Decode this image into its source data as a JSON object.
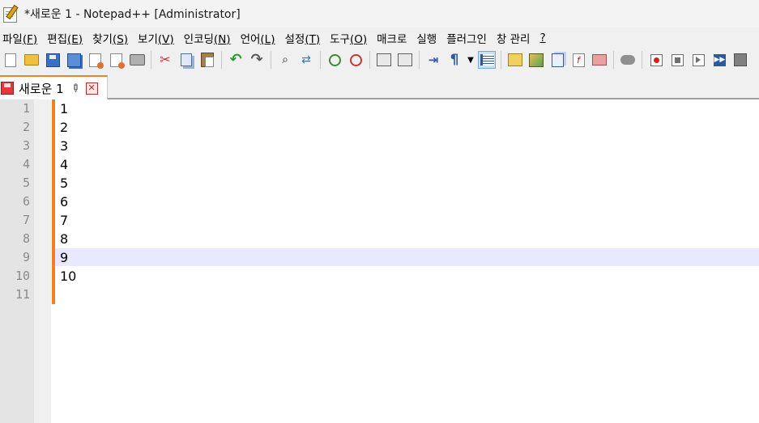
{
  "window": {
    "title": "*새로운 1 - Notepad++ [Administrator]"
  },
  "menu": {
    "items": [
      {
        "label": "파일",
        "accel": "(F)"
      },
      {
        "label": "편집",
        "accel": "(E)"
      },
      {
        "label": "찾기",
        "accel": "(S)"
      },
      {
        "label": "보기",
        "accel": "(V)"
      },
      {
        "label": "인코딩",
        "accel": "(N)"
      },
      {
        "label": "언어",
        "accel": "(L)"
      },
      {
        "label": "설정",
        "accel": "(T)"
      },
      {
        "label": "도구",
        "accel": "(O)"
      },
      {
        "label": "매크로",
        "accel": ""
      },
      {
        "label": "실행",
        "accel": ""
      },
      {
        "label": "플러그인",
        "accel": ""
      },
      {
        "label": "창 관리",
        "accel": ""
      },
      {
        "label": "",
        "accel": "?"
      }
    ]
  },
  "toolbar": {
    "icons": [
      "new-file-icon",
      "open-file-icon",
      "save-icon",
      "save-all-icon",
      "close-icon",
      "close-all-icon",
      "print-icon",
      "cut-icon",
      "copy-icon",
      "paste-icon",
      "undo-icon",
      "redo-icon",
      "find-icon",
      "replace-icon",
      "zoom-in-icon",
      "zoom-out-icon",
      "sync-vertical-icon",
      "sync-horizontal-icon",
      "word-wrap-icon",
      "show-all-chars-icon",
      "indent-guide-icon",
      "udl-icon",
      "doc-map-icon",
      "doc-list-icon",
      "function-list-icon",
      "folder-workspace-icon",
      "monitoring-icon",
      "record-macro-icon",
      "stop-record-icon",
      "playback-macro-icon",
      "run-macro-multiple-icon",
      "save-macro-icon"
    ]
  },
  "tabs": [
    {
      "label": "새로운 1",
      "modified": true,
      "active": true
    }
  ],
  "editor": {
    "lines": [
      "1",
      "2",
      "3",
      "4",
      "5",
      "6",
      "7",
      "8",
      "9",
      "10",
      ""
    ],
    "line_numbers": [
      "1",
      "2",
      "3",
      "4",
      "5",
      "6",
      "7",
      "8",
      "9",
      "10",
      "11"
    ],
    "current_line": 9,
    "colors": {
      "change_bar": "#f08020",
      "current_line_bg": "#e8e8ff",
      "gutter_bg": "#e4e4e4"
    }
  }
}
